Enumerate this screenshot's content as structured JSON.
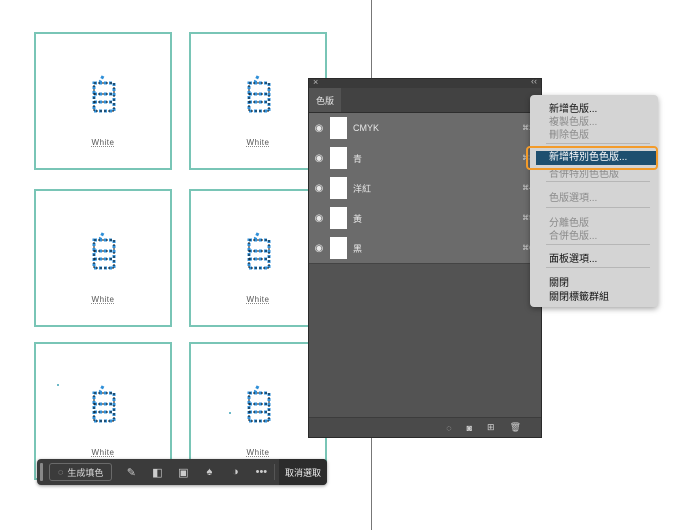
{
  "document": {
    "cards": [
      {
        "word": "White"
      },
      {
        "word": "White"
      },
      {
        "word": "White"
      },
      {
        "word": "White"
      },
      {
        "word": "White"
      },
      {
        "word": "White"
      }
    ]
  },
  "context_toolbar": {
    "generate_fill_label": "生成填色",
    "deselect_label": "取消選取",
    "more_label": "•••"
  },
  "channels_panel": {
    "tab_label": "色版",
    "channels": [
      {
        "name": "CMYK",
        "shortcut": "⌘2",
        "visible": true
      },
      {
        "name": "青",
        "shortcut": "⌘3",
        "visible": true
      },
      {
        "name": "洋紅",
        "shortcut": "⌘4",
        "visible": true
      },
      {
        "name": "黃",
        "shortcut": "⌘5",
        "visible": true
      },
      {
        "name": "黑",
        "shortcut": "⌘6",
        "visible": true
      }
    ]
  },
  "flyout_menu": {
    "items": [
      {
        "label": "新增色版...",
        "enabled": true
      },
      {
        "label": "複製色版...",
        "enabled": false
      },
      {
        "label": "刪除色版",
        "enabled": false
      },
      {
        "label": "新增特別色色版...",
        "enabled": true,
        "highlighted": true
      },
      {
        "label": "合併特別色色版",
        "enabled": false
      },
      {
        "label": "色版選項...",
        "enabled": false
      },
      {
        "label": "分離色版",
        "enabled": false
      },
      {
        "label": "合併色版...",
        "enabled": false
      },
      {
        "label": "面板選項...",
        "enabled": true
      },
      {
        "label": "關閉",
        "enabled": true
      },
      {
        "label": "關閉標籤群組",
        "enabled": true
      }
    ]
  },
  "colors": {
    "card_border": "#79c5b6",
    "glyph_blue": "#2f8fd8",
    "menu_highlight": "#1e4f6f",
    "callout_ring": "#f39b2a"
  }
}
